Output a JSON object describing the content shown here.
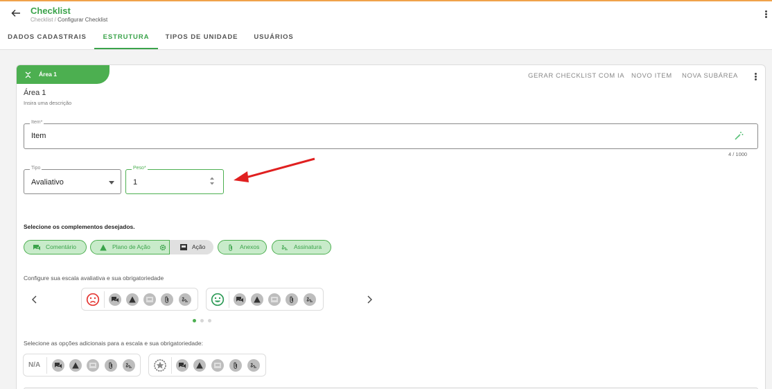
{
  "header": {
    "title": "Checklist",
    "breadcrumb_root": "Checklist /",
    "breadcrumb_current": "Configurar Checklist"
  },
  "tabs": [
    "DADOS CADASTRAIS",
    "ESTRUTURA",
    "TIPOS DE UNIDADE",
    "USUÁRIOS"
  ],
  "active_tab": "ESTRUTURA",
  "area": {
    "tag_label": "Área 1",
    "title": "Área 1",
    "description": "Insira uma descrição",
    "toolbar": {
      "generate_ai": "GERAR CHECKLIST COM IA",
      "new_item": "NOVO ITEM",
      "new_subarea": "NOVA SUBÁREA"
    }
  },
  "item_field": {
    "legend": "Item*",
    "value": "Item",
    "counter": "4 / 1000"
  },
  "tipo_field": {
    "legend": "Tipo",
    "value": "Avaliativo"
  },
  "peso_field": {
    "legend": "Peso*",
    "value": "1"
  },
  "complements": {
    "label": "Selecione os complementos desejados.",
    "chips": {
      "comentario": "Comentário",
      "plano_acao": "Plano de Ação",
      "acao": "Ação",
      "anexos": "Anexos",
      "assinatura": "Assinatura"
    }
  },
  "scale": {
    "label": "Configure sua escala avaliativa e sua obrigatoriedade",
    "page_index": 0,
    "page_count": 3
  },
  "extra": {
    "label": "Selecione as opções adicionais para a escala e sua obrigatoriedade:",
    "na_label": "N/A"
  },
  "colors": {
    "primary": "#4caf50",
    "accent_line": "#f0a24a",
    "sad_face": "#e53935",
    "happy_face": "#2e9b57",
    "arrow": "#e02020"
  }
}
